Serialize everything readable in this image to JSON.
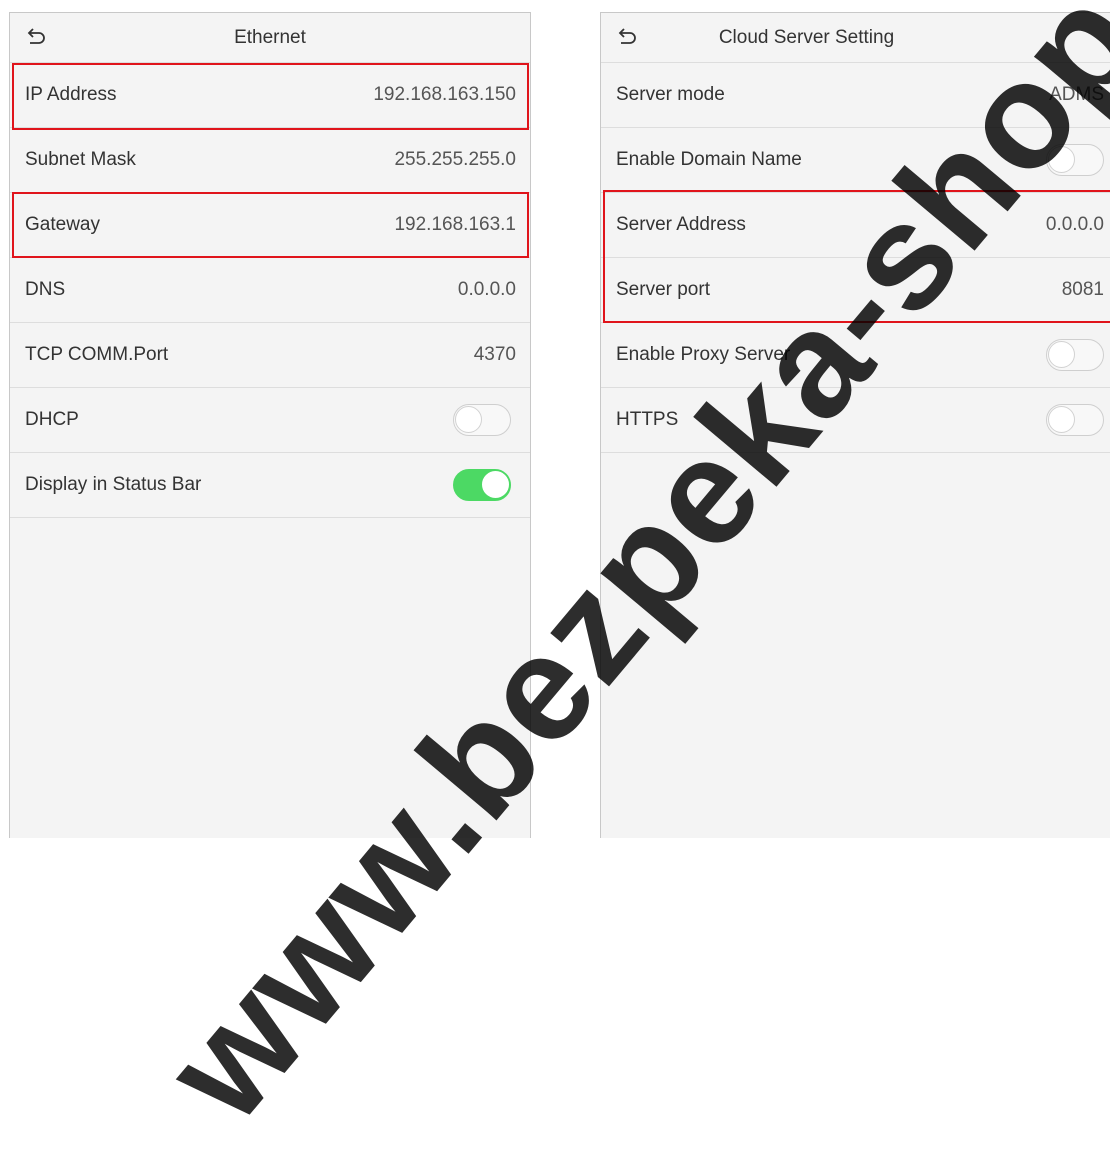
{
  "ethernet": {
    "title": "Ethernet",
    "rows": [
      {
        "label": "IP Address",
        "value": "192.168.163.150"
      },
      {
        "label": "Subnet Mask",
        "value": "255.255.255.0"
      },
      {
        "label": "Gateway",
        "value": "192.168.163.1"
      },
      {
        "label": "DNS",
        "value": "0.0.0.0"
      },
      {
        "label": "TCP COMM.Port",
        "value": "4370"
      },
      {
        "label": "DHCP",
        "toggle": "off"
      },
      {
        "label": "Display in Status Bar",
        "toggle": "on"
      }
    ]
  },
  "cloud": {
    "title": "Cloud Server Setting",
    "rows": [
      {
        "label": "Server mode",
        "value": "ADMS"
      },
      {
        "label": "Enable Domain Name",
        "toggle": "off"
      },
      {
        "label": "Server Address",
        "value": "0.0.0.0"
      },
      {
        "label": "Server port",
        "value": "8081"
      },
      {
        "label": "Enable Proxy Server",
        "toggle": "off"
      },
      {
        "label": "HTTPS",
        "toggle": "off"
      }
    ]
  },
  "icons": {
    "back": "back-arrow-icon"
  },
  "colors": {
    "highlight": "#e0141b",
    "toggle_on": "#4cd964",
    "panel_bg": "#f4f4f4"
  },
  "watermark": "www.bezpeka-shop.com"
}
